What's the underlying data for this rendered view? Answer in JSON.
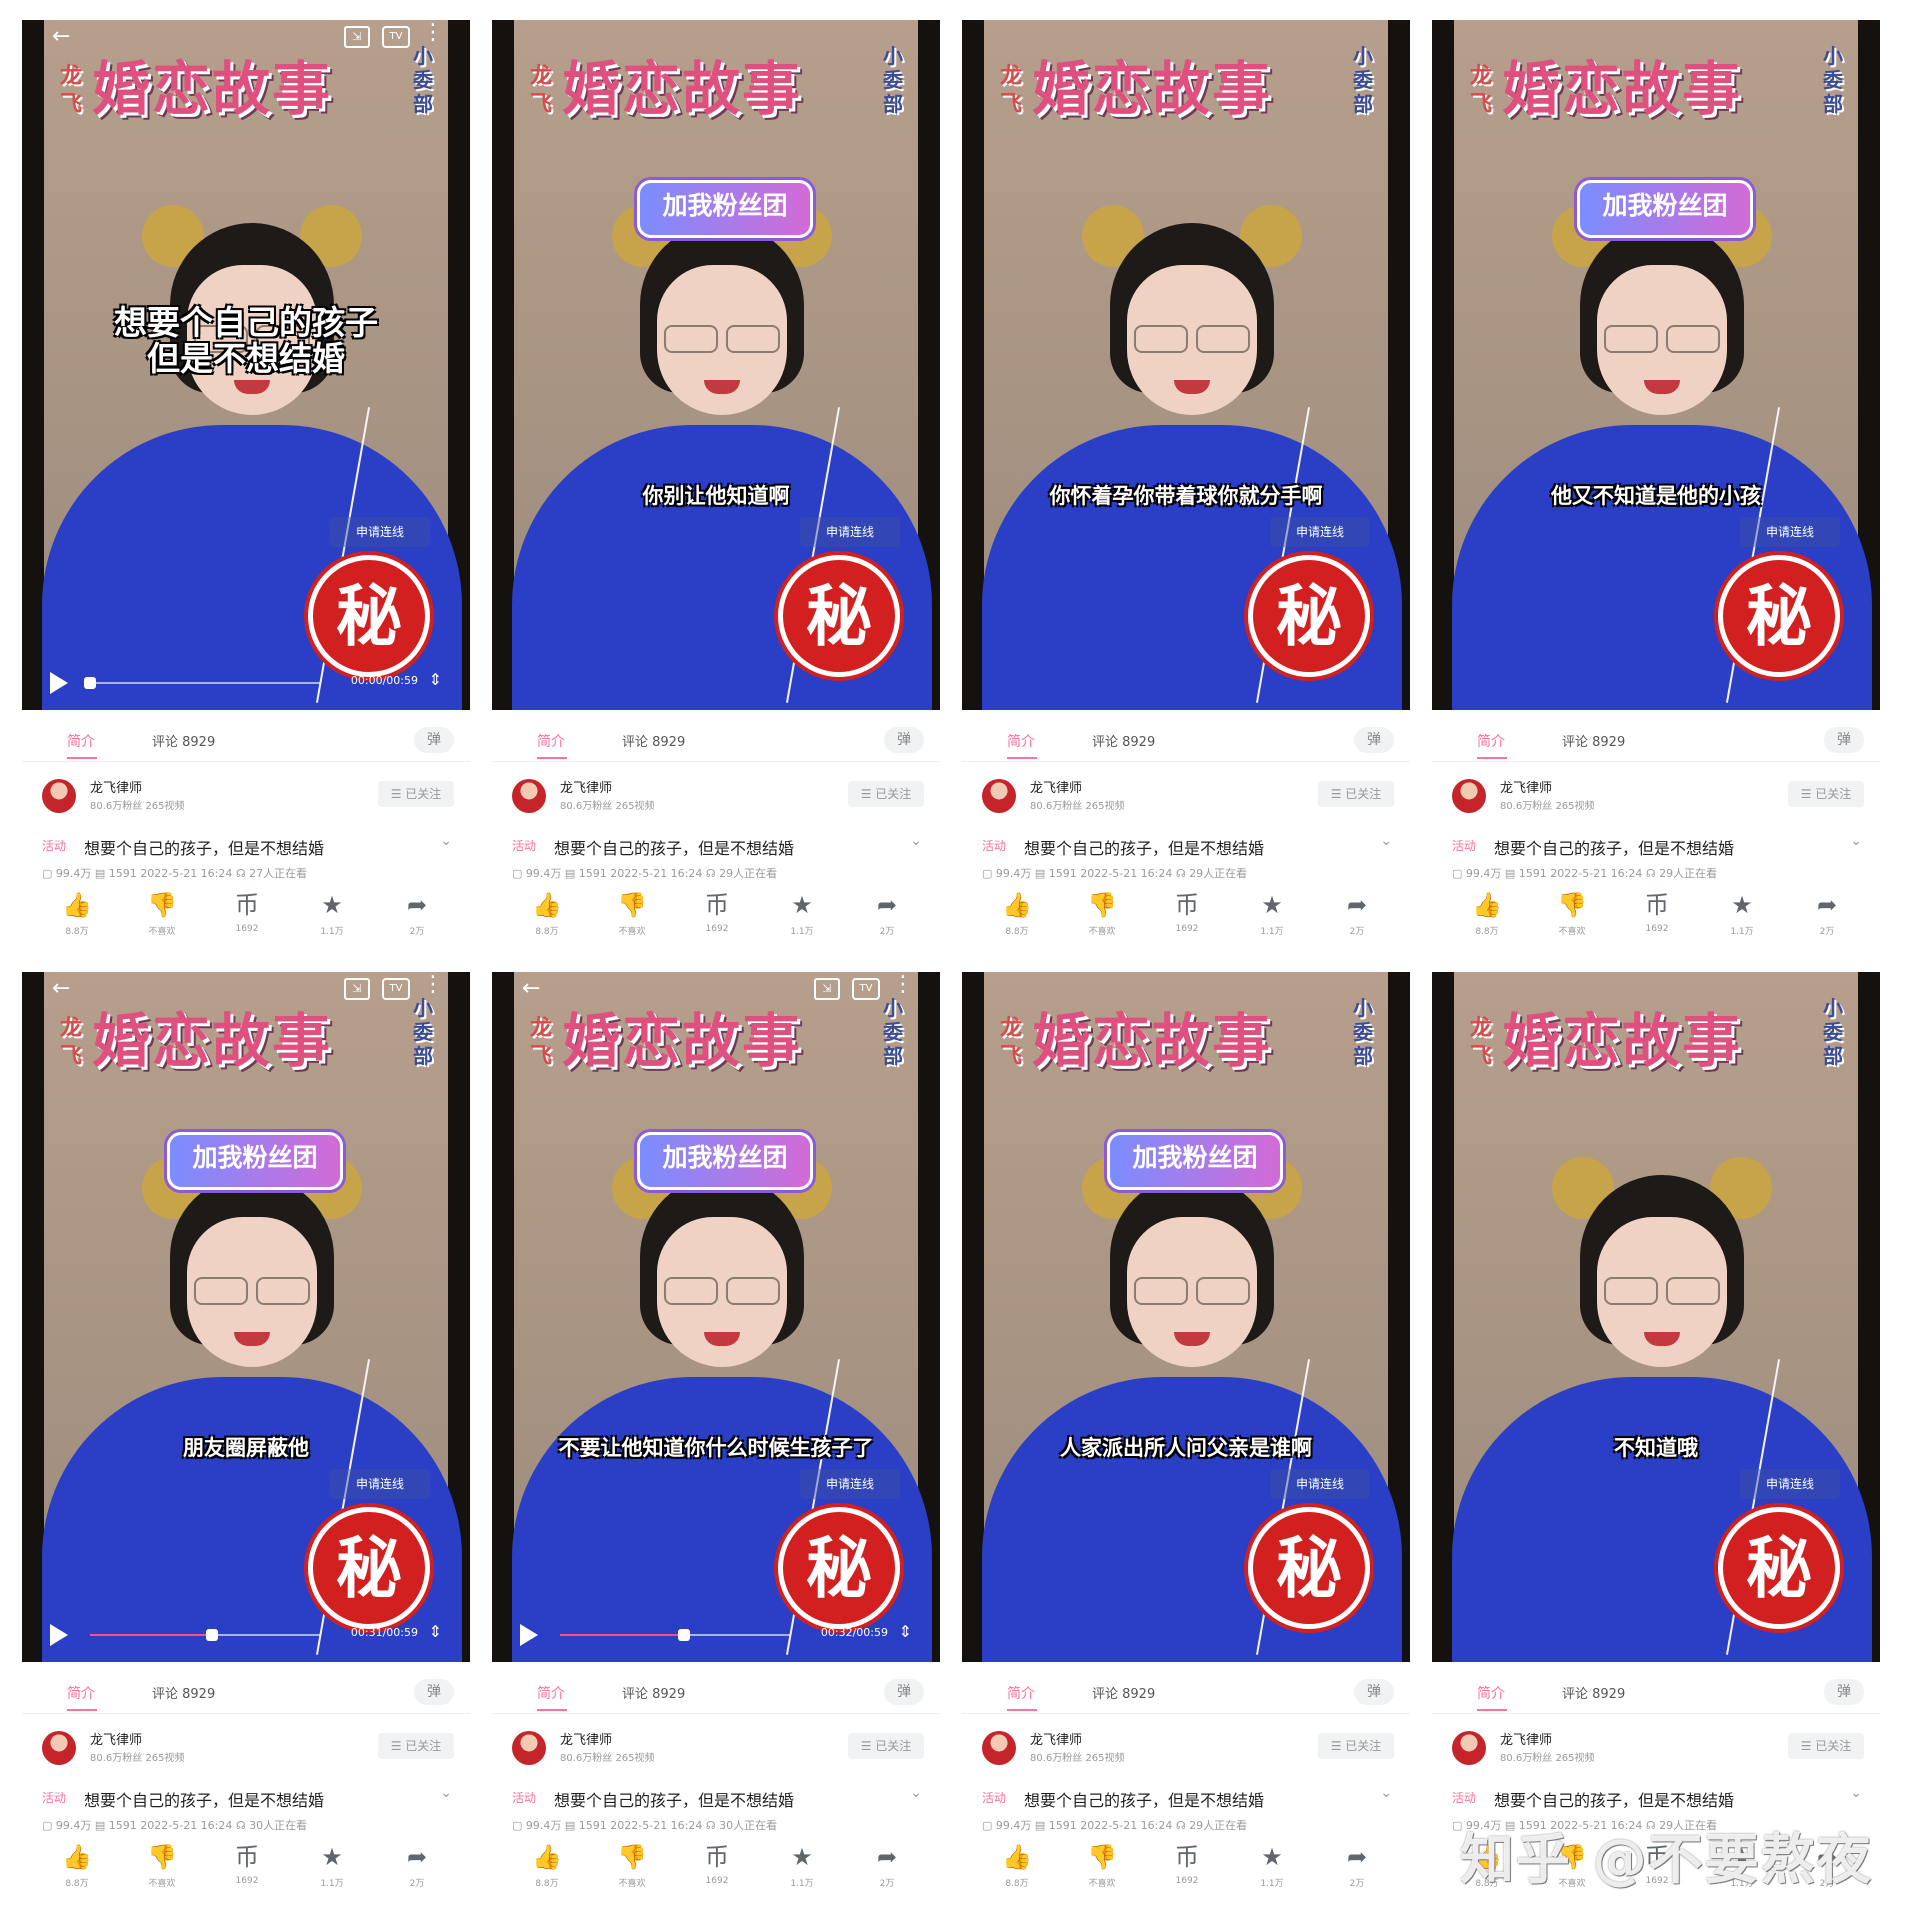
{
  "show": {
    "title_small": "龙飞",
    "title_main": "婚恋故事",
    "title_side": "小委部"
  },
  "overlay": {
    "fan_badge": "加我粉丝团",
    "lianxian": "申请连线",
    "secret": "秘"
  },
  "tabs": {
    "intro": "简介",
    "comments": "评论 8929"
  },
  "author": {
    "name": "龙飞律师",
    "meta": "80.6万粉丝   265视频",
    "follow": "☰ 已关注"
  },
  "video": {
    "tag": "活动",
    "title": "想要个自己的孩子，但是不想结婚"
  },
  "actions": [
    {
      "icon": "👍",
      "label": "8.8万"
    },
    {
      "icon": "👎",
      "label": "不喜欢"
    },
    {
      "icon": "币",
      "label": "1692"
    },
    {
      "icon": "★",
      "label": "1.1万"
    },
    {
      "icon": "➦",
      "label": "2万"
    }
  ],
  "panels": [
    {
      "subtitle": "想要个自己的孩子\n但是不想结婚",
      "subtitle_style": "top",
      "stats": "▢ 99.4万   ▤ 1591    2022-5-21 16:24   ☊ 27人正在看",
      "time": "00:00/00:59",
      "progress": 0.0,
      "controls": true,
      "badge": false
    },
    {
      "subtitle": "你别让他知道啊",
      "subtitle_style": "mid",
      "stats": "▢ 99.4万   ▤ 1591    2022-5-21 16:24   ☊ 29人正在看",
      "time": "",
      "progress": null,
      "controls": false,
      "badge": true
    },
    {
      "subtitle": "你怀着孕你带着球你就分手啊",
      "subtitle_style": "mid",
      "stats": "▢ 99.4万   ▤ 1591    2022-5-21 16:24   ☊ 29人正在看",
      "time": "",
      "progress": null,
      "controls": false,
      "badge": false
    },
    {
      "subtitle": "他又不知道是他的小孩",
      "subtitle_style": "mid",
      "stats": "▢ 99.4万   ▤ 1591    2022-5-21 16:24   ☊ 29人正在看",
      "time": "",
      "progress": null,
      "controls": false,
      "badge": true
    },
    {
      "subtitle": "朋友圈屏蔽他",
      "subtitle_style": "mid",
      "stats": "▢ 99.4万   ▤ 1591    2022-5-21 16:24   ☊ 30人正在看",
      "time": "00:31/00:59",
      "progress": 0.53,
      "controls": true,
      "badge": true
    },
    {
      "subtitle": "不要让他知道你什么时候生孩子了",
      "subtitle_style": "mid",
      "stats": "▢ 99.4万   ▤ 1591    2022-5-21 16:24   ☊ 30人正在看",
      "time": "00:32/00:59",
      "progress": 0.54,
      "controls": true,
      "badge": true
    },
    {
      "subtitle": "人家派出所人问父亲是谁啊",
      "subtitle_style": "mid",
      "stats": "▢ 99.4万   ▤ 1591    2022-5-21 16:24   ☊ 29人正在看",
      "time": "",
      "progress": null,
      "controls": false,
      "badge": true
    },
    {
      "subtitle": "不知道哦",
      "subtitle_style": "mid",
      "stats": "▢ 99.4万   ▤ 1591    2022-5-21 16:24   ☊ 29人正在看",
      "time": "",
      "progress": null,
      "controls": false,
      "badge": false
    }
  ],
  "watermark": "知乎 @不要熬夜"
}
